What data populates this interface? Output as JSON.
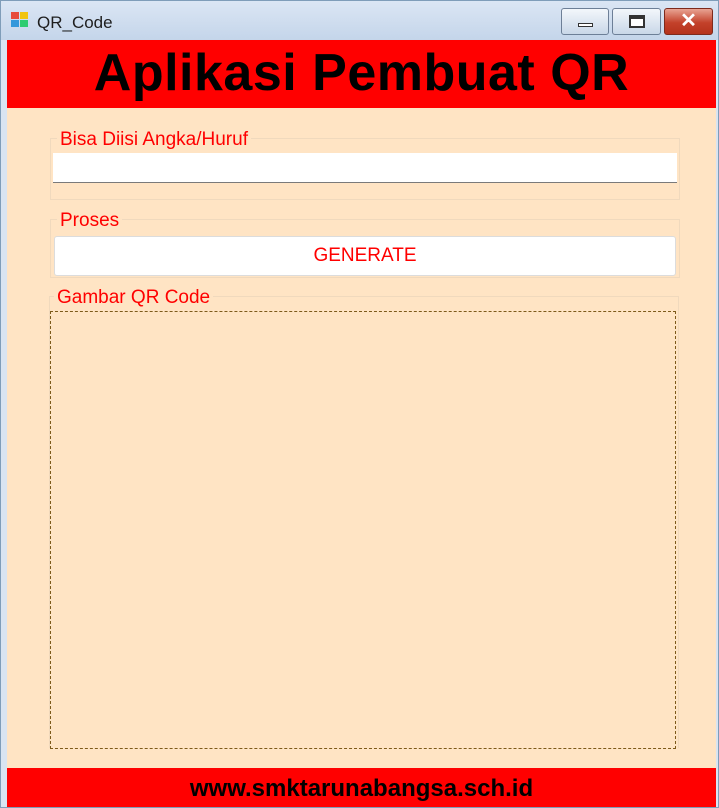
{
  "window": {
    "title": "QR_Code",
    "icon": "winforms-app-icon",
    "controls": {
      "minimize": "minimize-icon",
      "maximize": "maximize-icon",
      "close_glyph": "✕"
    }
  },
  "header": {
    "title": "Aplikasi Pembuat QR",
    "color": "#ff0000"
  },
  "input_group": {
    "label": "Bisa Diisi Angka/Huruf",
    "value": ""
  },
  "process_group": {
    "label": "Proses",
    "button_label": "GENERATE"
  },
  "qr_group": {
    "label": "Gambar QR Code"
  },
  "footer": {
    "text": "www.smktarunabangsa.sch.id"
  },
  "colors": {
    "accent": "#ff0000",
    "background": "#ffe4c4"
  }
}
